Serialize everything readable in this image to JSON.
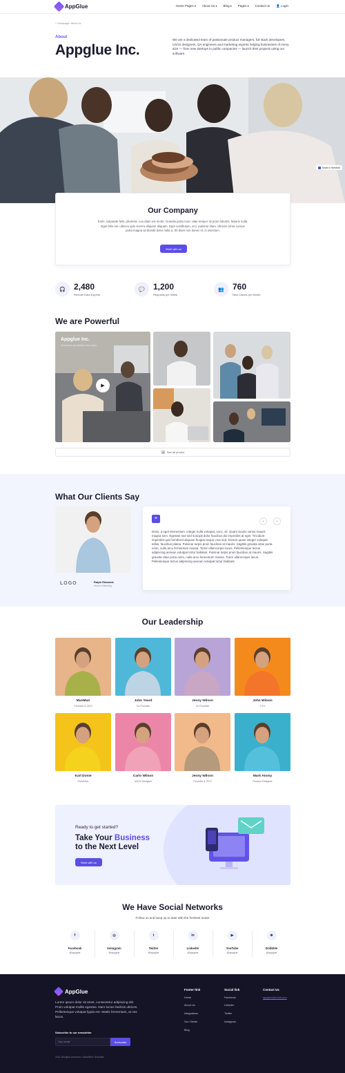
{
  "header": {
    "logo": "AppGlue",
    "nav": [
      {
        "label": "Home Pages",
        "dropdown": true
      },
      {
        "label": "About Us",
        "dropdown": true
      },
      {
        "label": "Blog",
        "dropdown": true
      },
      {
        "label": "Pages",
        "dropdown": true
      },
      {
        "label": "Contact us",
        "dropdown": false
      },
      {
        "label": "Login",
        "dropdown": false
      }
    ]
  },
  "breadcrumb": "Homepage / About Us",
  "hero": {
    "eyebrow": "About",
    "title": "Appglue Inc.",
    "description": "We are a dedicated team of passionate product managers, full stack developers, UX/UI designers, QA engineers and marketing experts helping businesses of every size — from new startups to public companies — launch their projects using our software."
  },
  "hero_badge": "Made in Webflow",
  "company": {
    "title": "Our Company",
    "text": "Enim, vulputate felis, pharetra. Leo diam est morbi. Gravida porta nunc vitae tempor sit proin lobortis. Mauris nulla. Eget felis nec ultrices quis viverra aliquam aliquam. Eget vestibulum, orci, pulvinar diam. Ultrices tortor cursus porta magna sit blandit dolor nulla a. Sit diam non donec et, in interdum.",
    "button": "Work with us"
  },
  "stats": [
    {
      "icon": "headset-icon",
      "value": "2,480",
      "label": "Remote Data Experts"
    },
    {
      "icon": "chat-icon",
      "value": "1,200",
      "label": "Requests per Week"
    },
    {
      "icon": "users-icon",
      "value": "760",
      "label": "New Clients per Month"
    }
  ],
  "powerful": {
    "title": "We are Powerful",
    "video_title": "Appglue Inc.",
    "video_sub": "Showreel by Martin McCurley",
    "see_all": "See all photos"
  },
  "testimonials": {
    "title": "What Our Clients Say",
    "logo_text": "LOGO",
    "author_name": "Ralph Edwards",
    "author_role": "Head of Marketing",
    "quote": "Dolor, a eget elementum, integer nulla volutpat, nunc, sit. Quam iaculis varius mauris magna sem. Egestas sed sed suscipit dolor faucibus dui imperdiet at eget. Tincidunt imperdiet quis hendrerit aliquam feugiat neque cras sed. Dictum quam integer volutpat tellus, faucibus platea. Pulvinar turpis proin faucibus at mauris. Sagittis gravida vitae porta enim, nulla arcu fermentum massa. Tortor ullamcorper lacus. Pellentesque lectus adipiscing aenean volutpat tortor habitant. Pulvinar turpis proin faucibus at mauris. Sagittis gravida vitae porta enim, nulla arcu fermentum massa. Tortor ullamcorper lacus. Pellentesque lectus adipiscing aenean volutpat tortor habitant."
  },
  "leadership": {
    "title": "Our Leadership",
    "members": [
      {
        "name": "MunMun",
        "role": "Founder & CEO",
        "bg": "#e8b48a",
        "shirt": "#a8b04a"
      },
      {
        "name": "John Yeard",
        "role": "Co Founder",
        "bg": "#4fb8d8",
        "shirt": "#bcd4e4"
      },
      {
        "name": "Jenny Wilson",
        "role": "Co Founder",
        "bg": "#b9a4d8",
        "shirt": "#c9a6c4"
      },
      {
        "name": "John Wilson",
        "role": "CTO",
        "bg": "#f58a1c",
        "shirt": "#f3752a"
      },
      {
        "name": "Karl Donie",
        "role": "Presenter",
        "bg": "#f5c41a",
        "shirt": "#f4d21e"
      },
      {
        "name": "Carlo Wilson",
        "role": "UI/UX Designer",
        "bg": "#ec86a8",
        "shirt": "#f0a2b6"
      },
      {
        "name": "Jenny Wilson",
        "role": "Founder & CEO",
        "bg": "#f2b98a",
        "shirt": "#b59a7c"
      },
      {
        "name": "Mark Atomy",
        "role": "Product Designer",
        "bg": "#3ab0cc",
        "shirt": "#54c0dc"
      }
    ]
  },
  "cta": {
    "eyebrow": "Ready to get started?",
    "title_1": "Take Your ",
    "title_hl": "Business",
    "title_2": "to the Next Level",
    "button": "Work with us"
  },
  "social": {
    "title": "We Have Social Networks",
    "subtitle": "Follow us and keep up to date with the freshest news!",
    "items": [
      {
        "icon": "facebook-icon",
        "glyph": "f",
        "name": "Facebook",
        "handle": "@appglue"
      },
      {
        "icon": "instagram-icon",
        "glyph": "◎",
        "name": "Instagram",
        "handle": "@appglue"
      },
      {
        "icon": "twitter-icon",
        "glyph": "t",
        "name": "Twitter",
        "handle": "@appglue"
      },
      {
        "icon": "linkedin-icon",
        "glyph": "in",
        "name": "LinkedIn",
        "handle": "@appglue"
      },
      {
        "icon": "youtube-icon",
        "glyph": "▶",
        "name": "YouTube",
        "handle": "@appglue"
      },
      {
        "icon": "dribbble-icon",
        "glyph": "⊛",
        "name": "Dribbble",
        "handle": "@appglue"
      }
    ]
  },
  "footer": {
    "logo": "AppGlue",
    "description": "Lorem ipsum dolor sit amet, consectetur adipiscing elit. Proin volutpat mollis egestas. Nam luctus facilisis ultrices. Pellentesque volutpat ligula est. Mattis fermentum, at nec lacus.",
    "subscribe_label": "Subscribe to our newsletter",
    "email_placeholder": "Your email",
    "subscribe_button": "Subscribe",
    "col1_title": "Footer-link",
    "col1_links": [
      "Home",
      "About Us",
      "Integrations",
      "Our Clients",
      "Blog"
    ],
    "col2_title": "Social link",
    "col2_links": [
      "Facebook",
      "LinkedIn",
      "Twitter",
      "Instagram"
    ],
    "col3_title": "Contact Us",
    "email": "appglue@email.com",
    "copyright": "2021 All rights reserved. Clickelt8ve Template"
  },
  "colors": {
    "accent": "#5b4ee6",
    "footer_bg": "#151326",
    "section_tint": "#f2f5fe"
  }
}
